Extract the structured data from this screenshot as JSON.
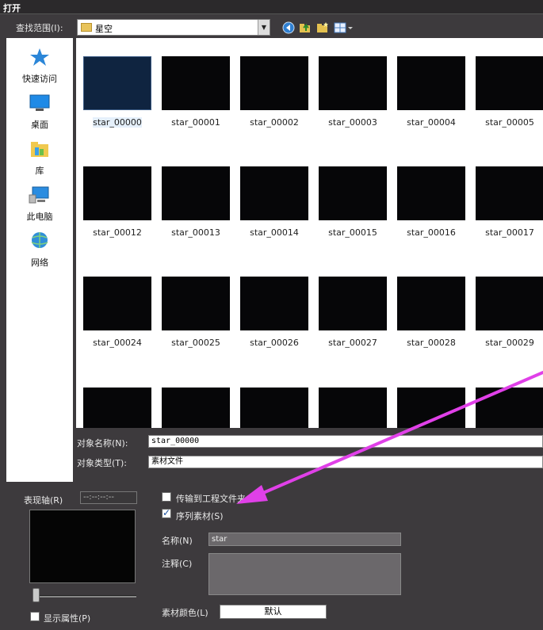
{
  "window": {
    "title": "打开"
  },
  "lookin": {
    "label": "查找范围(I):",
    "value": "星空"
  },
  "toolbar": {
    "icons": [
      "back-icon",
      "up-folder-icon",
      "new-folder-icon",
      "view-menu-icon"
    ]
  },
  "places": [
    {
      "label": "快速访问",
      "icon": "star-icon"
    },
    {
      "label": "桌面",
      "icon": "desktop-icon"
    },
    {
      "label": "库",
      "icon": "library-icon"
    },
    {
      "label": "此电脑",
      "icon": "computer-icon"
    },
    {
      "label": "网络",
      "icon": "network-icon"
    }
  ],
  "files": [
    [
      "star_00000",
      "star_00001",
      "star_00002",
      "star_00003",
      "star_00004",
      "star_00005"
    ],
    [
      "star_00012",
      "star_00013",
      "star_00014",
      "star_00015",
      "star_00016",
      "star_00017"
    ],
    [
      "star_00024",
      "star_00025",
      "star_00026",
      "star_00027",
      "star_00028",
      "star_00029"
    ]
  ],
  "selected_file": "star_00000",
  "object_name": {
    "label": "对象名称(N):",
    "value": "star_00000"
  },
  "object_type": {
    "label": "对象类型(T):",
    "value": "素材文件"
  },
  "preview": {
    "label": "表现轴(R)",
    "timecode": "--:--:--:--",
    "show_props_label": "显示属性(P)"
  },
  "options": {
    "transfer_label": "传输到工程文件夹(",
    "sequence_label": "序列素材(S)",
    "sequence_checked": true,
    "name_label": "名称(N)",
    "name_value": "star",
    "comment_label": "注释(C)",
    "color_label": "素材颜色(L)",
    "color_button": "默认"
  },
  "colors": {
    "annotation_arrow": "#e040e8",
    "background": "#3d3a3d"
  }
}
